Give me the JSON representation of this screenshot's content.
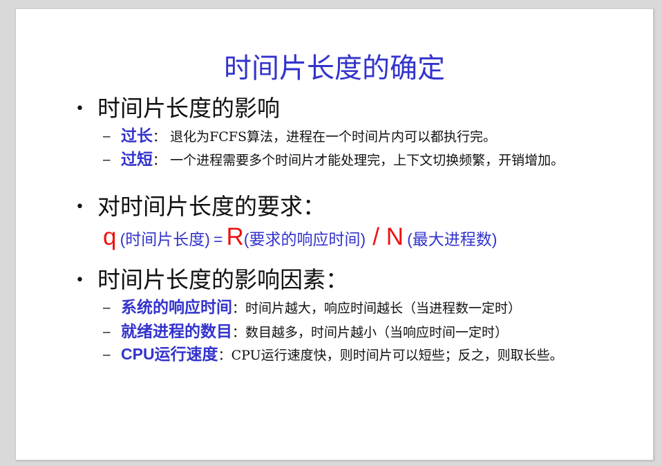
{
  "slide": {
    "title": "时间片长度的确定",
    "bullet1": {
      "text": "时间片长度的影响",
      "items": [
        {
          "keyword": "过长",
          "sep": "：",
          "text": "退化为FCFS算法，进程在一个时间片内可以都执行完。"
        },
        {
          "keyword": "过短",
          "sep": "：",
          "text": "一个进程需要多个时间片才能处理完，上下文切换频繁，开销增加。"
        }
      ]
    },
    "bullet2": {
      "text": "对时间片长度的要求："
    },
    "formula": {
      "q": "q",
      "q_desc": "(时间片长度)",
      "eq": "=",
      "r": "R",
      "r_desc": "(要求的响应时间)",
      "div": "/ N",
      "n_desc": "(最大进程数)"
    },
    "bullet3": {
      "text": "时间片长度的影响因素：",
      "items": [
        {
          "keyword": "系统的响应时间",
          "sep": "：",
          "text": "时间片越大，响应时间越长（当进程数一定时）"
        },
        {
          "keyword": "就绪进程的数目",
          "sep": "：",
          "text": "数目越多，时间片越小（当响应时间一定时）"
        },
        {
          "keyword": "CPU运行速度",
          "sep": "：",
          "text": "CPU运行速度快，则时间片可以短些；反之，则取长些。"
        }
      ]
    },
    "bullet_glyph": "•",
    "dash_glyph": "–",
    "colors": {
      "title": "#3333cc",
      "keyword": "#3333cc",
      "formula_red": "#ee1111",
      "text": "#111111"
    }
  }
}
